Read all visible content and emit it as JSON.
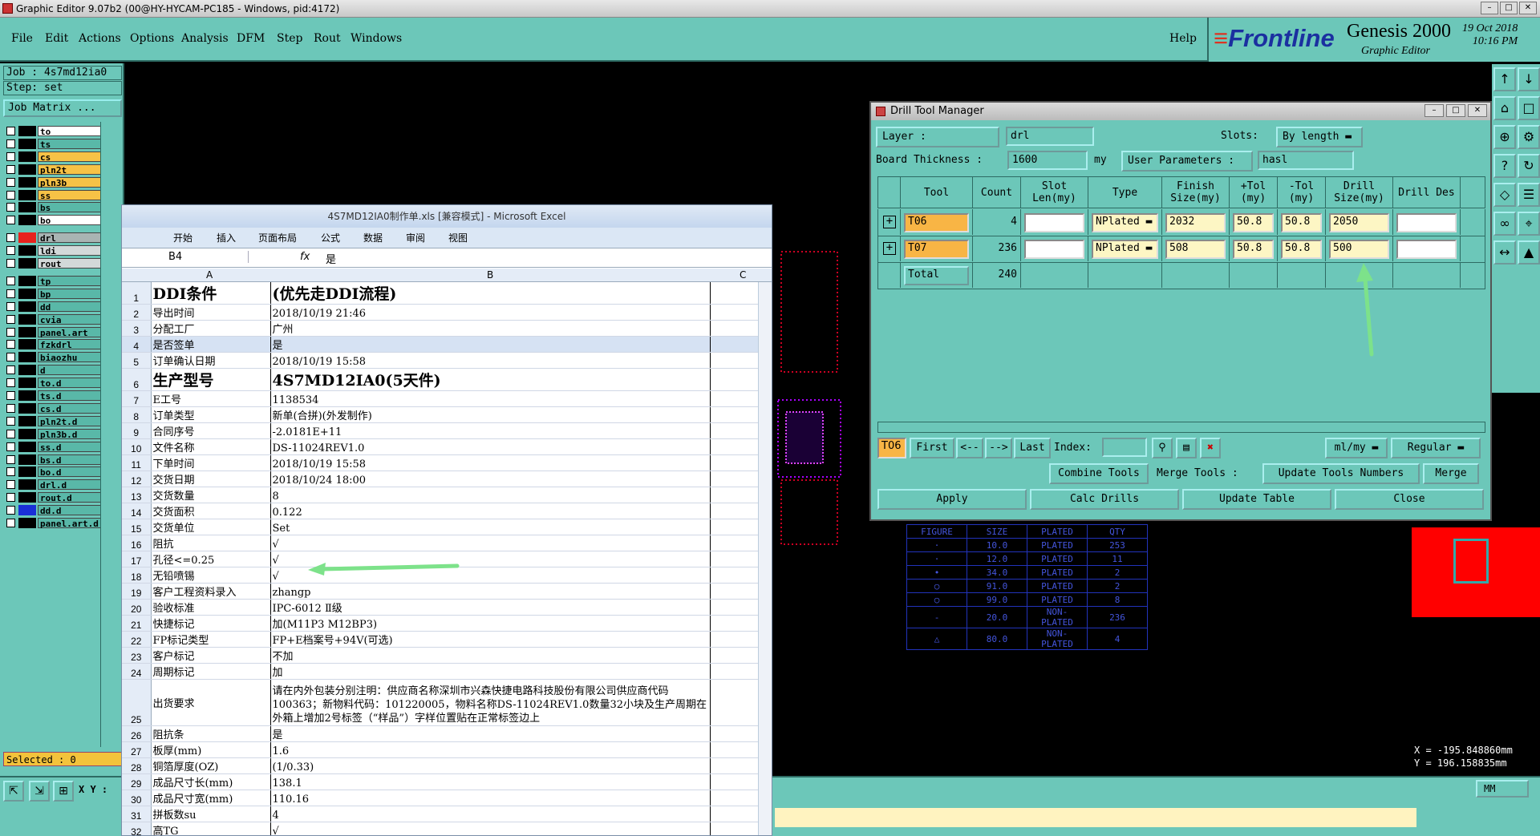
{
  "app": {
    "title": "Graphic Editor 9.07b2 (00@HY-HYCAM-PC185 - Windows, pid:4172)"
  },
  "menu": [
    "File",
    "Edit",
    "Actions",
    "Options",
    "Analysis",
    "DFM",
    "Step",
    "Rout",
    "Windows"
  ],
  "help": "Help",
  "brand": {
    "logo": "Frontline",
    "product": "Genesis 2000",
    "sub": "Graphic Editor",
    "date": "19 Oct 2018",
    "time": "10:16 PM"
  },
  "job": {
    "job": "Job : 4s7md12ia0",
    "step": "Step: set",
    "matrix": "Job Matrix ..."
  },
  "layers": [
    {
      "name": "to",
      "color": "#ffffff",
      "sw": "#000000"
    },
    {
      "name": "ts",
      "color": "#59b8a8",
      "sw": "#000000"
    },
    {
      "name": "cs",
      "color": "#f6c246",
      "sw": "#000000"
    },
    {
      "name": "pln2t",
      "color": "#f6c246",
      "sw": "#000000"
    },
    {
      "name": "pln3b",
      "color": "#f6c246",
      "sw": "#000000"
    },
    {
      "name": "ss",
      "color": "#f6c246",
      "sw": "#000000"
    },
    {
      "name": "bs",
      "color": "#59b8a8",
      "sw": "#000000"
    },
    {
      "name": "bo",
      "color": "#ffffff",
      "sw": "#000000"
    },
    {
      "name": "drl",
      "color": "#a9b4b3",
      "sw": "#e8221d"
    },
    {
      "name": "ldi",
      "color": "#d3d9d9",
      "sw": "#000000"
    },
    {
      "name": "rout",
      "color": "#d3d9d9",
      "sw": "#000000"
    },
    {
      "name": "tp",
      "color": "#59b8a8",
      "sw": "#000000"
    },
    {
      "name": "bp",
      "color": "#59b8a8",
      "sw": "#000000"
    },
    {
      "name": "dd",
      "color": "#59b8a8",
      "sw": "#000000"
    },
    {
      "name": "cvia",
      "color": "#59b8a8",
      "sw": "#000000"
    },
    {
      "name": "panel.art",
      "color": "#59b8a8",
      "sw": "#000000"
    },
    {
      "name": "fzkdrl",
      "color": "#59b8a8",
      "sw": "#000000"
    },
    {
      "name": "biaozhu",
      "color": "#59b8a8",
      "sw": "#000000"
    },
    {
      "name": "d",
      "color": "#59b8a8",
      "sw": "#000000"
    },
    {
      "name": "to.d",
      "color": "#59b8a8",
      "sw": "#000000"
    },
    {
      "name": "ts.d",
      "color": "#59b8a8",
      "sw": "#000000"
    },
    {
      "name": "cs.d",
      "color": "#59b8a8",
      "sw": "#000000"
    },
    {
      "name": "pln2t.d",
      "color": "#59b8a8",
      "sw": "#000000"
    },
    {
      "name": "pln3b.d",
      "color": "#59b8a8",
      "sw": "#000000"
    },
    {
      "name": "ss.d",
      "color": "#59b8a8",
      "sw": "#000000"
    },
    {
      "name": "bs.d",
      "color": "#59b8a8",
      "sw": "#000000"
    },
    {
      "name": "bo.d",
      "color": "#59b8a8",
      "sw": "#000000"
    },
    {
      "name": "drl.d",
      "color": "#59b8a8",
      "sw": "#000000"
    },
    {
      "name": "rout.d",
      "color": "#59b8a8",
      "sw": "#000000"
    },
    {
      "name": "dd.d",
      "color": "#59b8a8",
      "sw": "#1a2fd8"
    },
    {
      "name": "panel.art.d",
      "color": "#59b8a8",
      "sw": "#000000"
    }
  ],
  "selected": "Selected : 0",
  "xy_label": "X Y :",
  "coords": {
    "x": "X = -195.848860mm",
    "y": "Y = 196.158835mm"
  },
  "units": "MM",
  "dtm": {
    "title": "Drill Tool Manager",
    "layer_label": "Layer :",
    "layer_value": "drl",
    "slots_label": "Slots:",
    "slots_value": "By length",
    "thick_label": "Board Thickness :",
    "thick_value": "1600",
    "thick_unit": "my",
    "userp_label": "User Parameters :",
    "userp_value": "hasl",
    "headers": [
      "Tool",
      "Count",
      "Slot Len(my)",
      "Type",
      "Finish Size(my)",
      "+Tol (my)",
      "-Tol (my)",
      "Drill Size(my)",
      "Drill Des"
    ],
    "rows": [
      {
        "tool": "T06",
        "count": "4",
        "slot": "",
        "type": "NPlated",
        "finish": "2032",
        "ptol": "50.8",
        "ntol": "50.8",
        "drill": "2050",
        "des": ""
      },
      {
        "tool": "T07",
        "count": "236",
        "slot": "",
        "type": "NPlated",
        "finish": "508",
        "ptol": "50.8",
        "ntol": "50.8",
        "drill": "500",
        "des": ""
      }
    ],
    "total_label": "Total",
    "total_value": "240",
    "nav": {
      "cur": "T06",
      "first": "First",
      "prev": "<--",
      "next": "-->",
      "last": "Last",
      "index": "Index:",
      "unit": "ml/my",
      "mode": "Regular"
    },
    "combine": "Combine Tools",
    "merge_tools": "Merge Tools :",
    "update_nums": "Update Tools Numbers",
    "merge": "Merge",
    "apply": "Apply",
    "calc": "Calc Drills",
    "update_table": "Update Table",
    "close": "Close"
  },
  "figtable": {
    "head": [
      "FIGURE",
      "SIZE",
      "PLATED",
      "QTY"
    ],
    "rows": [
      [
        "·",
        "10.0",
        "PLATED",
        "253"
      ],
      [
        "·",
        "12.0",
        "PLATED",
        "11"
      ],
      [
        "•",
        "34.0",
        "PLATED",
        "2"
      ],
      [
        "○",
        "91.0",
        "PLATED",
        "2"
      ],
      [
        "○",
        "99.0",
        "PLATED",
        "8"
      ],
      [
        "-",
        "20.0",
        "NON-PLATED",
        "236"
      ],
      [
        "△",
        "80.0",
        "NON-PLATED",
        "4"
      ]
    ]
  },
  "excel": {
    "title": "4S7MD12IA0制作单.xls [兼容模式] - Microsoft Excel",
    "tabs": [
      "开始",
      "插入",
      "页面布局",
      "公式",
      "数据",
      "审阅",
      "视图"
    ],
    "cellref": "B4",
    "fx": "fx",
    "formula": "是",
    "cols": [
      "A",
      "B",
      "C"
    ],
    "rows": [
      [
        "1",
        "DDI条件",
        "(优先走DDI流程)"
      ],
      [
        "2",
        "导出时间",
        "2018/10/19 21:46"
      ],
      [
        "3",
        "分配工厂",
        "广州"
      ],
      [
        "4",
        "是否签单",
        "是"
      ],
      [
        "5",
        "订单确认日期",
        "2018/10/19 15:58"
      ],
      [
        "6",
        "生产型号",
        "4S7MD12IA0(5天件)"
      ],
      [
        "7",
        "E工号",
        "1138534"
      ],
      [
        "8",
        "订单类型",
        "新单(合拼)(外发制作)"
      ],
      [
        "9",
        "合同序号",
        "-2.0181E+11"
      ],
      [
        "10",
        "文件名称",
        "DS-11024REV1.0"
      ],
      [
        "11",
        "下单时间",
        "2018/10/19 15:58"
      ],
      [
        "12",
        "交货日期",
        "2018/10/24 18:00"
      ],
      [
        "13",
        "交货数量",
        "8"
      ],
      [
        "14",
        "交货面积",
        "0.122"
      ],
      [
        "15",
        "交货单位",
        "Set"
      ],
      [
        "16",
        "阻抗",
        "√"
      ],
      [
        "17",
        "孔径<=0.25",
        "√"
      ],
      [
        "18",
        "无铅喷锡",
        "√"
      ],
      [
        "19",
        "客户工程资料录入",
        "zhangp"
      ],
      [
        "20",
        "验收标准",
        "IPC-6012 Ⅱ级"
      ],
      [
        "21",
        "快捷标记",
        "加(M11P3 M12BP3)"
      ],
      [
        "22",
        "FP标记类型",
        "FP+E档案号+94V(可选)"
      ],
      [
        "23",
        "客户标记",
        "不加"
      ],
      [
        "24",
        "周期标记",
        "加"
      ],
      [
        "25",
        "出货要求",
        "请在内外包装分别注明：供应商名称深圳市兴森快捷电路科技股份有限公司供应商代码100363；新物料代码：101220005，物料名称DS-11024REV1.0数量32小块及生产周期在外箱上增加2号标签（“样品”）字样位置贴在正常标签边上"
      ],
      [
        "26",
        "阻抗条",
        "是"
      ],
      [
        "27",
        "板厚(mm)",
        "1.6"
      ],
      [
        "28",
        "铜箔厚度(OZ)",
        "(1/0.33)"
      ],
      [
        "29",
        "成品尺寸长(mm)",
        "138.1"
      ],
      [
        "30",
        "成品尺寸宽(mm)",
        "110.16"
      ],
      [
        "31",
        "拼板数su",
        "4"
      ],
      [
        "32",
        "高TG",
        "√"
      ]
    ]
  }
}
